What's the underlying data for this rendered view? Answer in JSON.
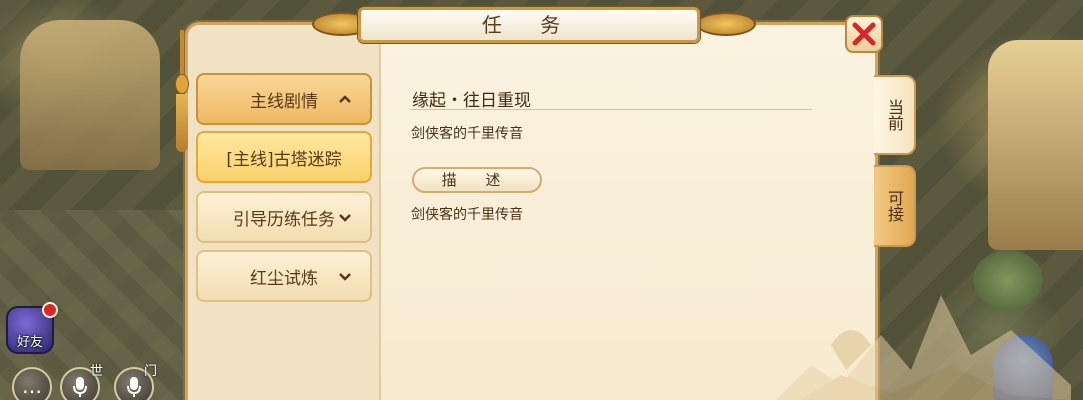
{
  "window": {
    "title": "任 务",
    "close_icon": "close-x-icon"
  },
  "sidebar": {
    "items": [
      {
        "label": "主线剧情",
        "state": "expanded",
        "icon": "chevron-up-icon"
      },
      {
        "label": "[主线]古塔迷踪",
        "state": "selected",
        "icon": ""
      },
      {
        "label": "引导历练任务",
        "state": "collapsed",
        "icon": "chevron-down-icon"
      },
      {
        "label": "红尘试炼",
        "state": "collapsed",
        "icon": "chevron-down-icon"
      }
    ]
  },
  "content": {
    "quest_title": "缘起・往日重现",
    "giver": "剑侠客的千里传音",
    "desc_label": "描 述",
    "desc_text": "剑侠客的千里传音"
  },
  "tabs": [
    {
      "label": "当前",
      "active": true
    },
    {
      "label": "可接",
      "active": false
    }
  ],
  "hud": {
    "friends_label": "好友",
    "world_tag": "世",
    "sect_tag": "门",
    "chat_icon": "chat-bubble-icon",
    "mic_icon": "microphone-icon"
  },
  "colors": {
    "panel": "#f6ead1",
    "accent": "#caa768",
    "close_red": "#d8262b",
    "text": "#4a3218"
  }
}
